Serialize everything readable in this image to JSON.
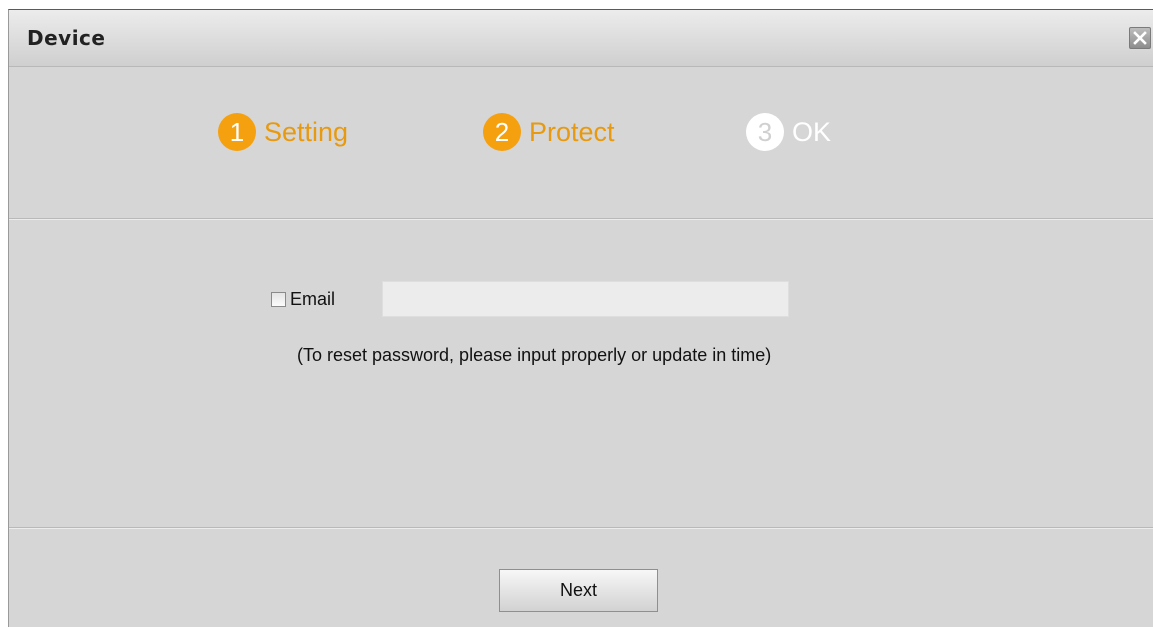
{
  "dialog": {
    "title": "Device",
    "close_icon": "close-icon"
  },
  "steps": [
    {
      "number": "1",
      "label": "Setting",
      "state": "active"
    },
    {
      "number": "2",
      "label": "Protect",
      "state": "active"
    },
    {
      "number": "3",
      "label": "OK",
      "state": "inactive"
    }
  ],
  "form": {
    "email_label": "Email",
    "email_checked": false,
    "email_value": "",
    "email_placeholder": "",
    "hint": "(To reset password, please input properly or update in time)"
  },
  "footer": {
    "next_label": "Next"
  },
  "colors": {
    "step_active": "#f5a00f",
    "step_inactive": "#ffffff",
    "panel_background": "#d6d6d6"
  }
}
